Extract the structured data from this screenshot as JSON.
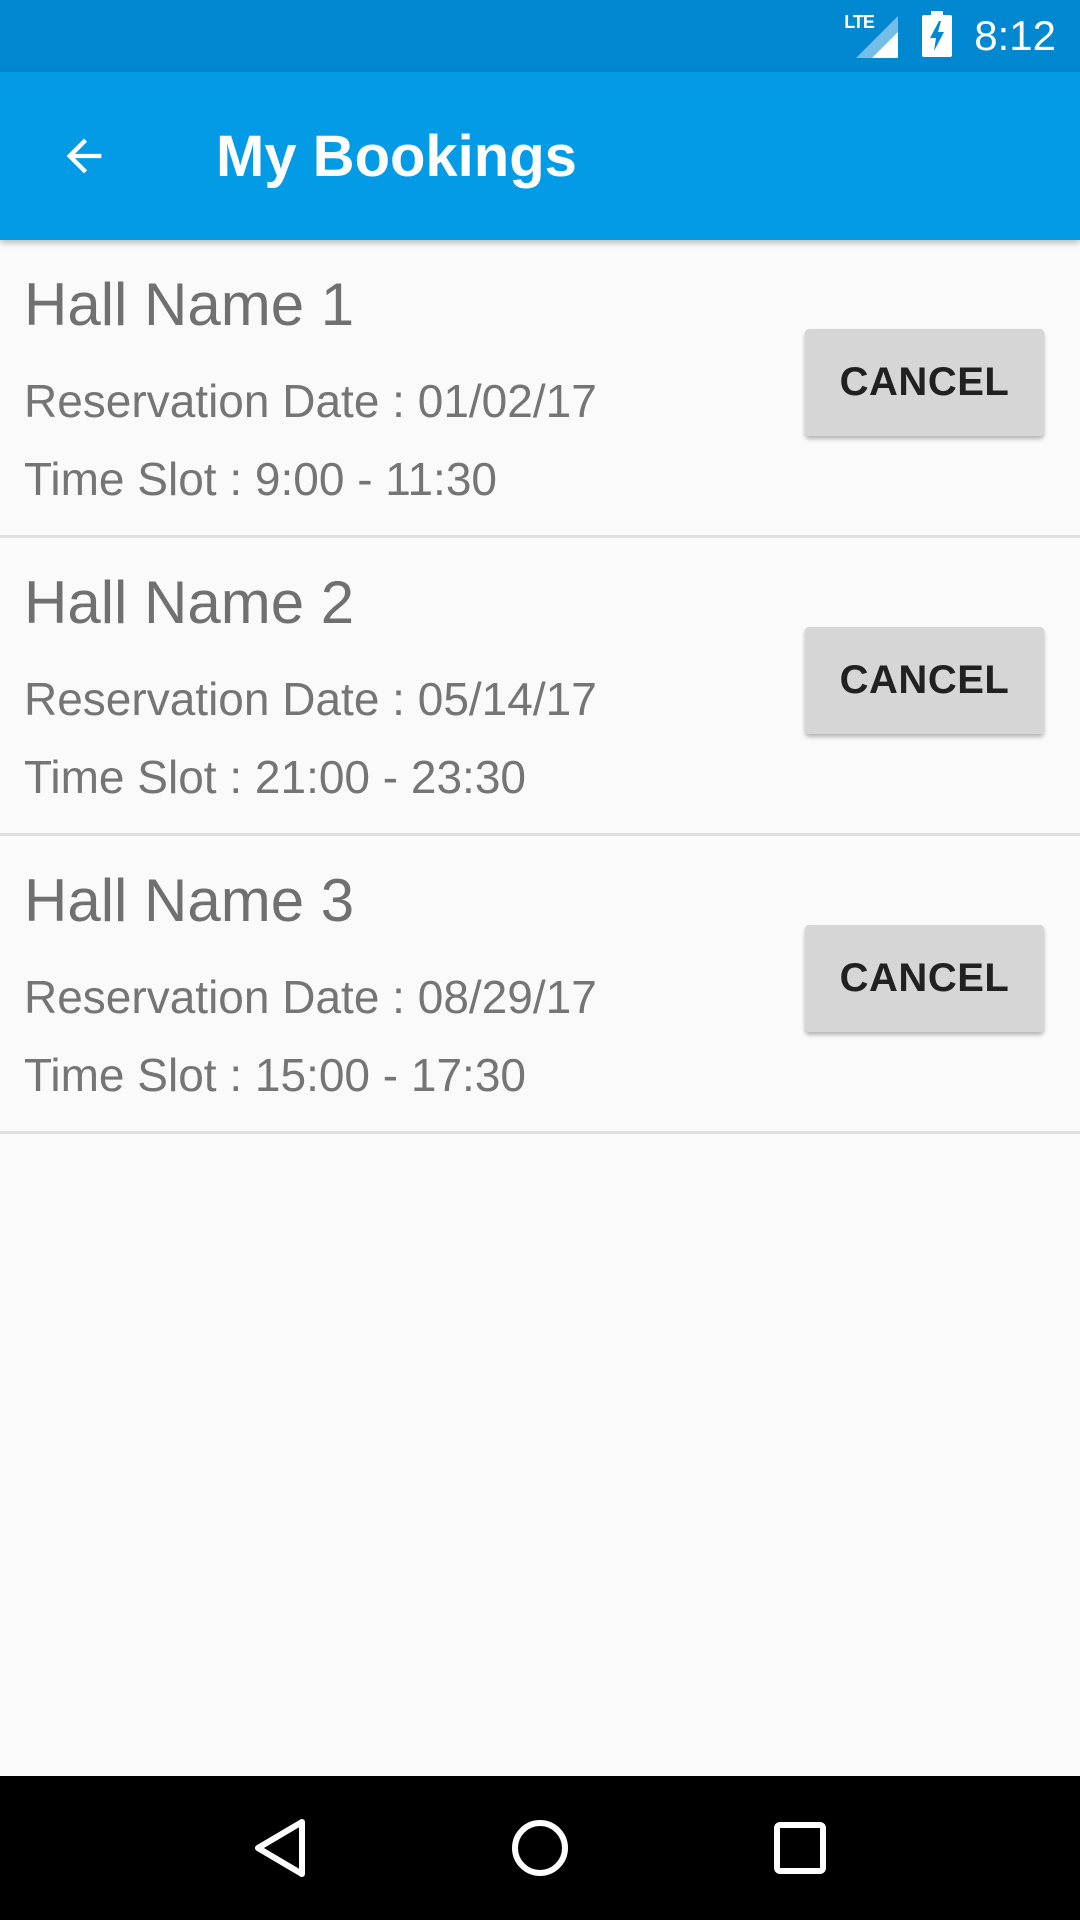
{
  "status_bar": {
    "network_label": "LTE",
    "time": "8:12",
    "icons": [
      "signal-icon",
      "battery-charging-icon"
    ]
  },
  "app_bar": {
    "title": "My Bookings",
    "back_icon": "arrow-back-icon",
    "color": "#039be5"
  },
  "bookings": [
    {
      "hall": "Hall Name 1",
      "date": "Reservation Date : 01/02/17",
      "slot": "Time Slot : 9:00 - 11:30",
      "action": "CANCEL"
    },
    {
      "hall": "Hall Name 2",
      "date": "Reservation Date : 05/14/17",
      "slot": "Time Slot : 21:00 - 23:30",
      "action": "CANCEL"
    },
    {
      "hall": "Hall Name 3",
      "date": "Reservation Date : 08/29/17",
      "slot": "Time Slot : 15:00 - 17:30",
      "action": "CANCEL"
    }
  ],
  "nav_bar": {
    "icons": [
      "back-triangle-icon",
      "home-circle-icon",
      "recents-square-icon"
    ]
  }
}
